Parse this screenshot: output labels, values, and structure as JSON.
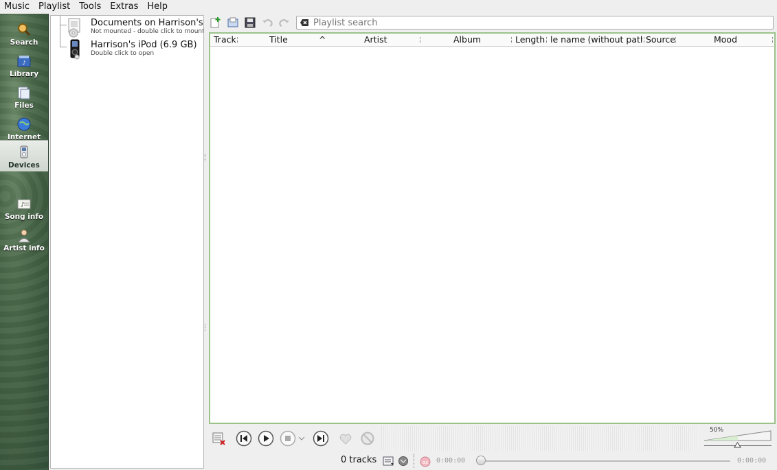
{
  "menu": [
    "Music",
    "Playlist",
    "Tools",
    "Extras",
    "Help"
  ],
  "sidebar": {
    "items": [
      {
        "label": "Search",
        "icon": "search-icon"
      },
      {
        "label": "Library",
        "icon": "library-icon"
      },
      {
        "label": "Files",
        "icon": "files-icon"
      },
      {
        "label": "Internet",
        "icon": "internet-icon"
      },
      {
        "label": "Devices",
        "icon": "devices-icon",
        "active": true
      },
      {
        "label": "Song info",
        "icon": "song-info-icon"
      },
      {
        "label": "Artist info",
        "icon": "artist-info-icon"
      }
    ]
  },
  "devices": [
    {
      "name": "Documents on Harrison's",
      "subtitle": "Not mounted - double click to mount",
      "icon": "document-drive-icon"
    },
    {
      "name": "Harrison's iPod (6.9 GB)",
      "subtitle": "Double click to open",
      "icon": "ipod-icon"
    }
  ],
  "toolbar": {
    "search_placeholder": "Playlist search"
  },
  "playlist": {
    "columns": [
      "Track",
      "Title",
      "Artist",
      "Album",
      "Length",
      "le name (without path",
      "Source",
      "Mood"
    ],
    "sort_indicator": "^",
    "rows": []
  },
  "volume": {
    "label": "50%",
    "level": 0.5
  },
  "status": {
    "tracks": "0 tracks",
    "elapsed": "0:00:00",
    "remaining": "0:00:00"
  },
  "colors": {
    "accent_border": "#9cc28a",
    "sidebar_green": "#3d5a3e"
  }
}
